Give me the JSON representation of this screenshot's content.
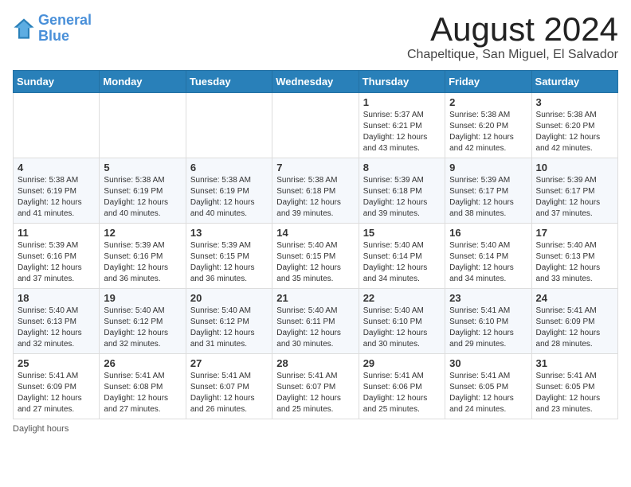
{
  "header": {
    "logo_line1": "General",
    "logo_line2": "Blue",
    "month_year": "August 2024",
    "location": "Chapeltique, San Miguel, El Salvador"
  },
  "days_of_week": [
    "Sunday",
    "Monday",
    "Tuesday",
    "Wednesday",
    "Thursday",
    "Friday",
    "Saturday"
  ],
  "footer": {
    "daylight_label": "Daylight hours"
  },
  "weeks": [
    [
      {
        "day": "",
        "info": ""
      },
      {
        "day": "",
        "info": ""
      },
      {
        "day": "",
        "info": ""
      },
      {
        "day": "",
        "info": ""
      },
      {
        "day": "1",
        "info": "Sunrise: 5:37 AM\nSunset: 6:21 PM\nDaylight: 12 hours\nand 43 minutes."
      },
      {
        "day": "2",
        "info": "Sunrise: 5:38 AM\nSunset: 6:20 PM\nDaylight: 12 hours\nand 42 minutes."
      },
      {
        "day": "3",
        "info": "Sunrise: 5:38 AM\nSunset: 6:20 PM\nDaylight: 12 hours\nand 42 minutes."
      }
    ],
    [
      {
        "day": "4",
        "info": "Sunrise: 5:38 AM\nSunset: 6:19 PM\nDaylight: 12 hours\nand 41 minutes."
      },
      {
        "day": "5",
        "info": "Sunrise: 5:38 AM\nSunset: 6:19 PM\nDaylight: 12 hours\nand 40 minutes."
      },
      {
        "day": "6",
        "info": "Sunrise: 5:38 AM\nSunset: 6:19 PM\nDaylight: 12 hours\nand 40 minutes."
      },
      {
        "day": "7",
        "info": "Sunrise: 5:38 AM\nSunset: 6:18 PM\nDaylight: 12 hours\nand 39 minutes."
      },
      {
        "day": "8",
        "info": "Sunrise: 5:39 AM\nSunset: 6:18 PM\nDaylight: 12 hours\nand 39 minutes."
      },
      {
        "day": "9",
        "info": "Sunrise: 5:39 AM\nSunset: 6:17 PM\nDaylight: 12 hours\nand 38 minutes."
      },
      {
        "day": "10",
        "info": "Sunrise: 5:39 AM\nSunset: 6:17 PM\nDaylight: 12 hours\nand 37 minutes."
      }
    ],
    [
      {
        "day": "11",
        "info": "Sunrise: 5:39 AM\nSunset: 6:16 PM\nDaylight: 12 hours\nand 37 minutes."
      },
      {
        "day": "12",
        "info": "Sunrise: 5:39 AM\nSunset: 6:16 PM\nDaylight: 12 hours\nand 36 minutes."
      },
      {
        "day": "13",
        "info": "Sunrise: 5:39 AM\nSunset: 6:15 PM\nDaylight: 12 hours\nand 36 minutes."
      },
      {
        "day": "14",
        "info": "Sunrise: 5:40 AM\nSunset: 6:15 PM\nDaylight: 12 hours\nand 35 minutes."
      },
      {
        "day": "15",
        "info": "Sunrise: 5:40 AM\nSunset: 6:14 PM\nDaylight: 12 hours\nand 34 minutes."
      },
      {
        "day": "16",
        "info": "Sunrise: 5:40 AM\nSunset: 6:14 PM\nDaylight: 12 hours\nand 34 minutes."
      },
      {
        "day": "17",
        "info": "Sunrise: 5:40 AM\nSunset: 6:13 PM\nDaylight: 12 hours\nand 33 minutes."
      }
    ],
    [
      {
        "day": "18",
        "info": "Sunrise: 5:40 AM\nSunset: 6:13 PM\nDaylight: 12 hours\nand 32 minutes."
      },
      {
        "day": "19",
        "info": "Sunrise: 5:40 AM\nSunset: 6:12 PM\nDaylight: 12 hours\nand 32 minutes."
      },
      {
        "day": "20",
        "info": "Sunrise: 5:40 AM\nSunset: 6:12 PM\nDaylight: 12 hours\nand 31 minutes."
      },
      {
        "day": "21",
        "info": "Sunrise: 5:40 AM\nSunset: 6:11 PM\nDaylight: 12 hours\nand 30 minutes."
      },
      {
        "day": "22",
        "info": "Sunrise: 5:40 AM\nSunset: 6:10 PM\nDaylight: 12 hours\nand 30 minutes."
      },
      {
        "day": "23",
        "info": "Sunrise: 5:41 AM\nSunset: 6:10 PM\nDaylight: 12 hours\nand 29 minutes."
      },
      {
        "day": "24",
        "info": "Sunrise: 5:41 AM\nSunset: 6:09 PM\nDaylight: 12 hours\nand 28 minutes."
      }
    ],
    [
      {
        "day": "25",
        "info": "Sunrise: 5:41 AM\nSunset: 6:09 PM\nDaylight: 12 hours\nand 27 minutes."
      },
      {
        "day": "26",
        "info": "Sunrise: 5:41 AM\nSunset: 6:08 PM\nDaylight: 12 hours\nand 27 minutes."
      },
      {
        "day": "27",
        "info": "Sunrise: 5:41 AM\nSunset: 6:07 PM\nDaylight: 12 hours\nand 26 minutes."
      },
      {
        "day": "28",
        "info": "Sunrise: 5:41 AM\nSunset: 6:07 PM\nDaylight: 12 hours\nand 25 minutes."
      },
      {
        "day": "29",
        "info": "Sunrise: 5:41 AM\nSunset: 6:06 PM\nDaylight: 12 hours\nand 25 minutes."
      },
      {
        "day": "30",
        "info": "Sunrise: 5:41 AM\nSunset: 6:05 PM\nDaylight: 12 hours\nand 24 minutes."
      },
      {
        "day": "31",
        "info": "Sunrise: 5:41 AM\nSunset: 6:05 PM\nDaylight: 12 hours\nand 23 minutes."
      }
    ]
  ]
}
